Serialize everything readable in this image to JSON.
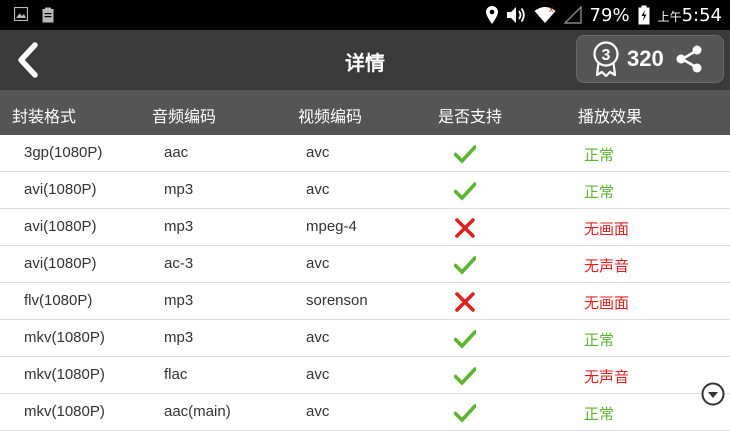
{
  "statusbar": {
    "battery": "79%",
    "ampm": "上午",
    "time": "5:54"
  },
  "header": {
    "title": "详情",
    "badge_number": "3",
    "score": "320"
  },
  "colors": {
    "ok": "#5cb531",
    "bad": "#e02020"
  },
  "table": {
    "headers": [
      "封装格式",
      "音频编码",
      "视频编码",
      "是否支持",
      "播放效果"
    ],
    "rows": [
      {
        "container": "3gp(1080P)",
        "audio": "aac",
        "video": "avc",
        "supported": true,
        "effect": "正常"
      },
      {
        "container": "avi(1080P)",
        "audio": "mp3",
        "video": "avc",
        "supported": true,
        "effect": "正常"
      },
      {
        "container": "avi(1080P)",
        "audio": "mp3",
        "video": "mpeg-4",
        "supported": false,
        "effect": "无画面"
      },
      {
        "container": "avi(1080P)",
        "audio": "ac-3",
        "video": "avc",
        "supported": true,
        "effect": "无声音"
      },
      {
        "container": "flv(1080P)",
        "audio": "mp3",
        "video": "sorenson",
        "supported": false,
        "effect": "无画面"
      },
      {
        "container": "mkv(1080P)",
        "audio": "mp3",
        "video": "avc",
        "supported": true,
        "effect": "正常"
      },
      {
        "container": "mkv(1080P)",
        "audio": "flac",
        "video": "avc",
        "supported": true,
        "effect": "无声音"
      },
      {
        "container": "mkv(1080P)",
        "audio": "aac(main)",
        "video": "avc",
        "supported": true,
        "effect": "正常"
      }
    ]
  }
}
